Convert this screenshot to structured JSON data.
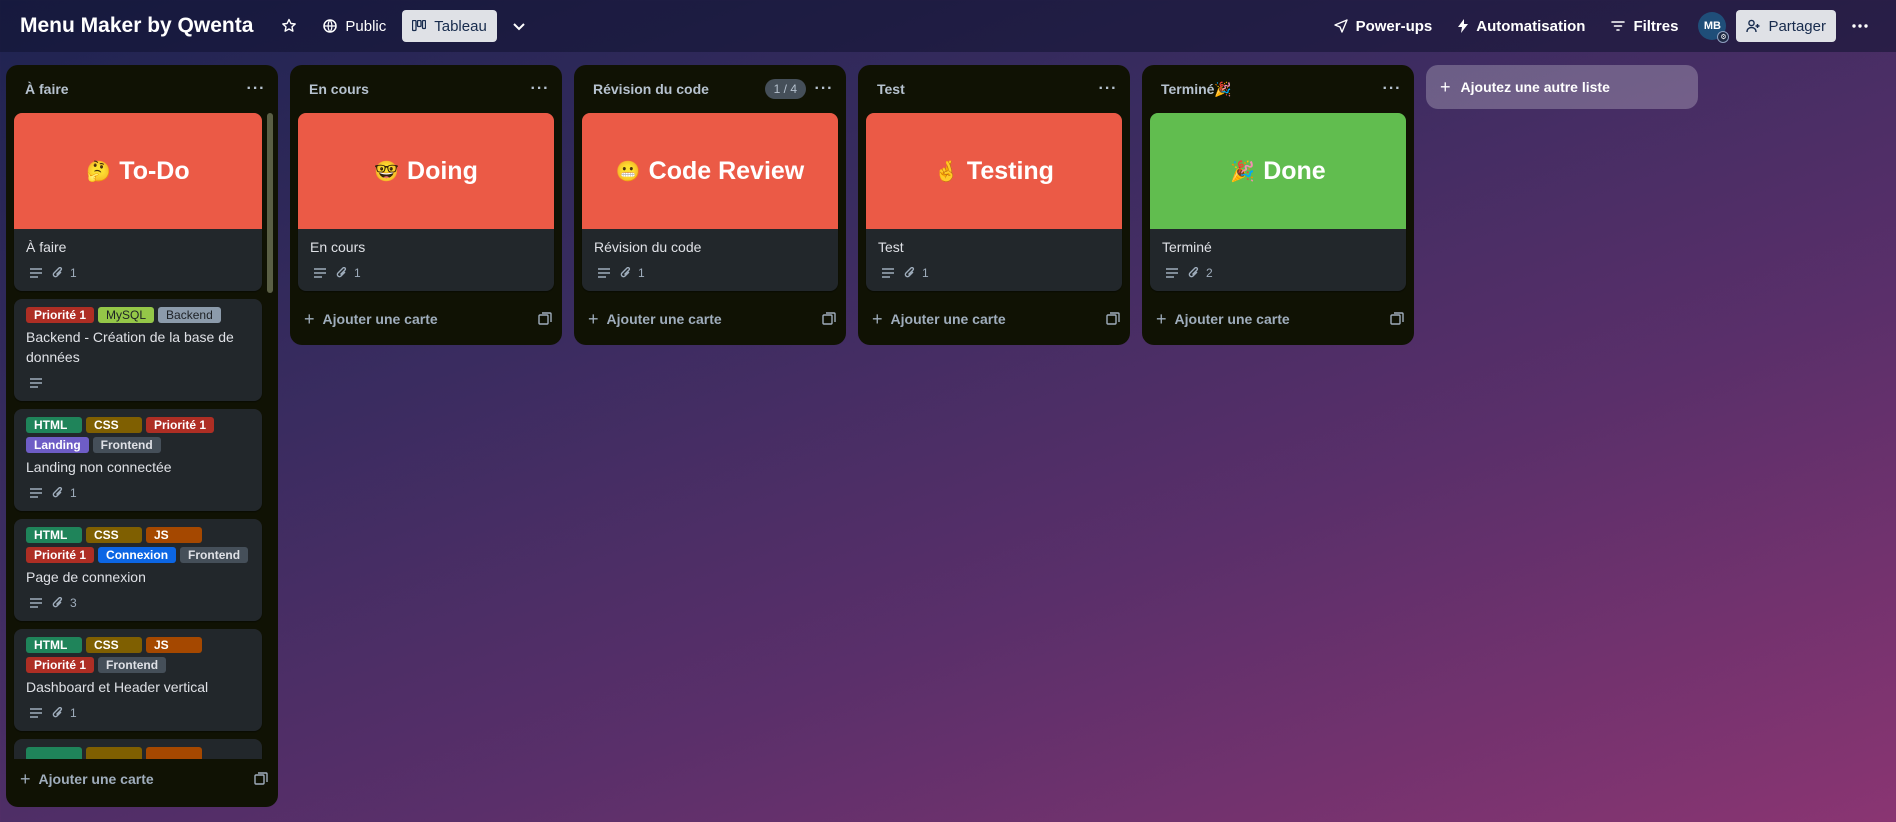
{
  "topbar": {
    "board_title": "Menu Maker by Qwenta",
    "visibility_label": "Public",
    "view_label": "Tableau",
    "powerups_label": "Power-ups",
    "automation_label": "Automatisation",
    "filters_label": "Filtres",
    "avatar_initials": "MB",
    "share_label": "Partager"
  },
  "colors": {
    "cover_red": "#eb5a46",
    "cover_green": "#61bd4f"
  },
  "lists": [
    {
      "name": "À faire",
      "add_card_label": "Ajouter une carte",
      "cover_card": {
        "emoji": "🤔",
        "cover_text": "To-Do",
        "title": "À faire",
        "attachments": "1"
      },
      "cards": [
        {
          "labels": [
            "Priorité 1",
            "MySQL",
            "Backend"
          ],
          "title": "Backend - Création de la base de données"
        },
        {
          "labels": [
            "HTML",
            "CSS",
            "Priorité 1",
            "Landing",
            "Frontend"
          ],
          "title": "Landing non connectée",
          "attachments": "1"
        },
        {
          "labels": [
            "HTML",
            "CSS",
            "JS",
            "Priorité 1",
            "Connexion",
            "Frontend"
          ],
          "title": "Page de connexion",
          "attachments": "3"
        },
        {
          "labels": [
            "HTML",
            "CSS",
            "JS",
            "Priorité 1",
            "Frontend"
          ],
          "title": "Dashboard et Header vertical",
          "attachments": "1"
        }
      ]
    },
    {
      "name": "En cours",
      "add_card_label": "Ajouter une carte",
      "cover_card": {
        "emoji": "🤓",
        "cover_text": "Doing",
        "title": "En cours",
        "attachments": "1"
      }
    },
    {
      "name": "Révision du code",
      "count": "1 / 4",
      "add_card_label": "Ajouter une carte",
      "cover_card": {
        "emoji": "😬",
        "cover_text": "Code Review",
        "title": "Révision du code",
        "attachments": "1"
      }
    },
    {
      "name": "Test",
      "add_card_label": "Ajouter une carte",
      "cover_card": {
        "emoji": "🤞",
        "cover_text": "Testing",
        "title": "Test",
        "attachments": "1"
      }
    },
    {
      "name": "Terminé🎉",
      "add_card_label": "Ajouter une carte",
      "cover_card": {
        "emoji": "🎉",
        "cover_text": "Done",
        "title": "Terminé",
        "attachments": "2"
      }
    }
  ],
  "add_list_label": "Ajoutez une autre liste"
}
